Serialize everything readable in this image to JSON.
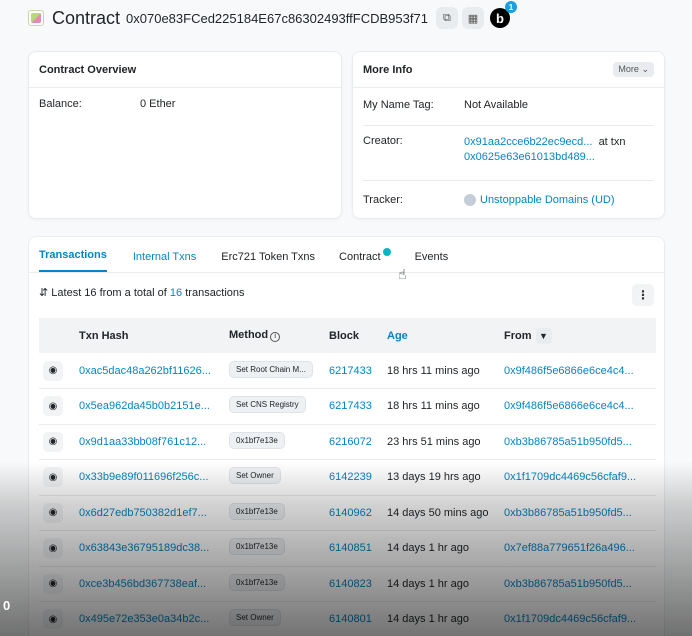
{
  "header": {
    "title": "Contract",
    "address": "0x070e83FCed225184E67c86302493ffFCDB953f71",
    "notification_count": "1",
    "badge_letter": "b"
  },
  "overview": {
    "title": "Contract Overview",
    "balance_label": "Balance:",
    "balance_value": "0 Ether"
  },
  "more_info": {
    "title": "More Info",
    "more_button": "More",
    "name_tag_label": "My Name Tag:",
    "name_tag_value": "Not Available",
    "creator_label": "Creator:",
    "creator_address": "0x91aa2cce6b22ec9ecd...",
    "creator_at": "at txn",
    "creator_txn": "0x0625e63e61013bd489...",
    "tracker_label": "Tracker:",
    "tracker_value": "Unstoppable Domains (UD)"
  },
  "tabs": [
    "Transactions",
    "Internal Txns",
    "Erc721 Token Txns",
    "Contract",
    "Events"
  ],
  "summary": {
    "prefix": "Latest 16 from a total of",
    "total": "16",
    "suffix": "transactions"
  },
  "table": {
    "headers": {
      "txn_hash": "Txn Hash",
      "method": "Method",
      "block": "Block",
      "age": "Age",
      "from": "From"
    },
    "rows": [
      {
        "hash": "0xac5dac48a262bf11626...",
        "method": "Set Root Chain M...",
        "block": "6217433",
        "age": "18 hrs 11 mins ago",
        "from": "0x9f486f5e6866e6ce4c4..."
      },
      {
        "hash": "0x5ea962da45b0b2151e...",
        "method": "Set CNS Registry",
        "block": "6217433",
        "age": "18 hrs 11 mins ago",
        "from": "0x9f486f5e6866e6ce4c4..."
      },
      {
        "hash": "0x9d1aa33bb08f761c12...",
        "method": "0x1bf7e13e",
        "block": "6216072",
        "age": "23 hrs 51 mins ago",
        "from": "0xb3b86785a51b950fd5..."
      },
      {
        "hash": "0x33b9e89f011696f256c...",
        "method": "Set Owner",
        "block": "6142239",
        "age": "13 days 19 hrs ago",
        "from": "0x1f1709dc4469c56cfaf9..."
      },
      {
        "hash": "0x6d27edb750382d1ef7...",
        "method": "0x1bf7e13e",
        "block": "6140962",
        "age": "14 days 50 mins ago",
        "from": "0xb3b86785a51b950fd5..."
      },
      {
        "hash": "0x63843e36795189dc38...",
        "method": "0x1bf7e13e",
        "block": "6140851",
        "age": "14 days 1 hr ago",
        "from": "0x7ef88a779651f26a496..."
      },
      {
        "hash": "0xce3b456bd367738eaf...",
        "method": "0x1bf7e13e",
        "block": "6140823",
        "age": "14 days 1 hr ago",
        "from": "0xb3b86785a51b950fd5..."
      },
      {
        "hash": "0x495e72e353e0a34b2c...",
        "method": "Set Owner",
        "block": "6140801",
        "age": "14 days 1 hr ago",
        "from": "0x1f1709dc4469c56cfaf9..."
      }
    ]
  },
  "overlay_text": "0",
  "colors": {
    "link": "#0784c3",
    "verified": "#0ab6c0",
    "badge": "#1a9fe0"
  }
}
